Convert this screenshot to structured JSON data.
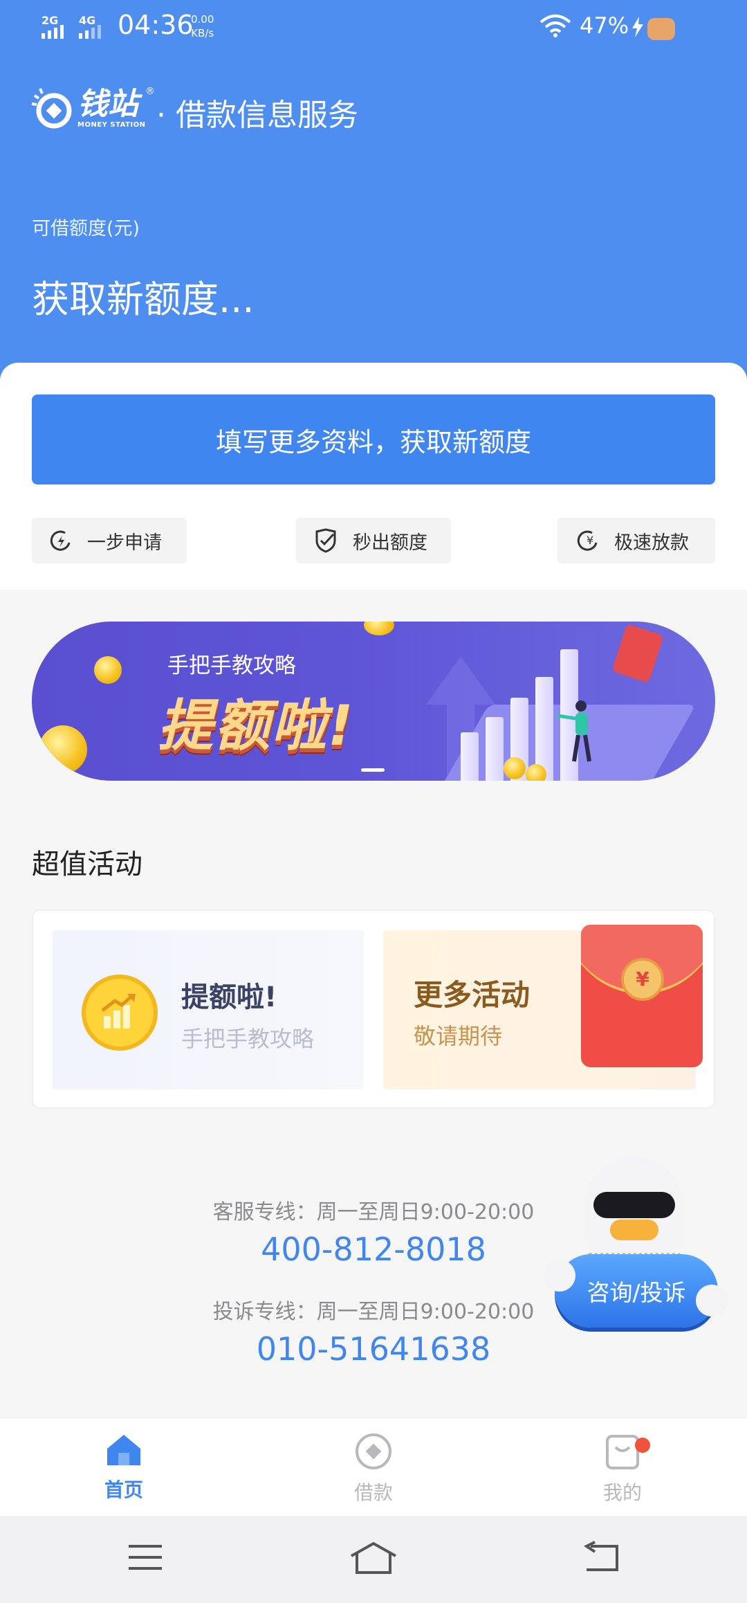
{
  "status": {
    "sim1": "2G",
    "sim2": "4G",
    "time": "04:36",
    "speed_value": "0.00",
    "speed_unit": "KB/s",
    "battery": "47%"
  },
  "header": {
    "logo_name": "钱站",
    "logo_sub": "MONEY STATION",
    "logo_reg": "®",
    "title": "· 借款信息服务",
    "quota_label": "可借额度(元)",
    "quota_value": "获取新额度..."
  },
  "card": {
    "main_button": "填写更多资料，获取新额度",
    "features": [
      {
        "label": "一步申请",
        "icon": "lightning-refresh-icon"
      },
      {
        "label": "秒出额度",
        "icon": "shield-check-icon"
      },
      {
        "label": "极速放款",
        "icon": "yuan-refresh-icon"
      }
    ]
  },
  "banner": {
    "subtitle": "手把手教攻略",
    "headline": "提额啦!"
  },
  "activities": {
    "section_title": "超值活动",
    "items": [
      {
        "title": "提额啦!",
        "subtitle": "手把手教攻略",
        "icon": "coin-chart-icon"
      },
      {
        "title": "更多活动",
        "subtitle": "敬请期待",
        "icon": "red-envelope-icon"
      }
    ]
  },
  "contact": {
    "service_label": "客服专线：周一至周日9:00-20:00",
    "service_phone": "400-812-8018",
    "complaint_label": "投诉专线：周一至周日9:00-20:00",
    "complaint_phone": "010-51641638",
    "consult_button": "咨询/投诉"
  },
  "tabbar": {
    "active_color": "#3f86f0",
    "inactive_color": "#b8b8bd",
    "items": [
      {
        "label": "首页",
        "icon": "home-icon"
      },
      {
        "label": "借款",
        "icon": "loan-coin-icon"
      },
      {
        "label": "我的",
        "icon": "profile-bag-icon"
      }
    ]
  }
}
